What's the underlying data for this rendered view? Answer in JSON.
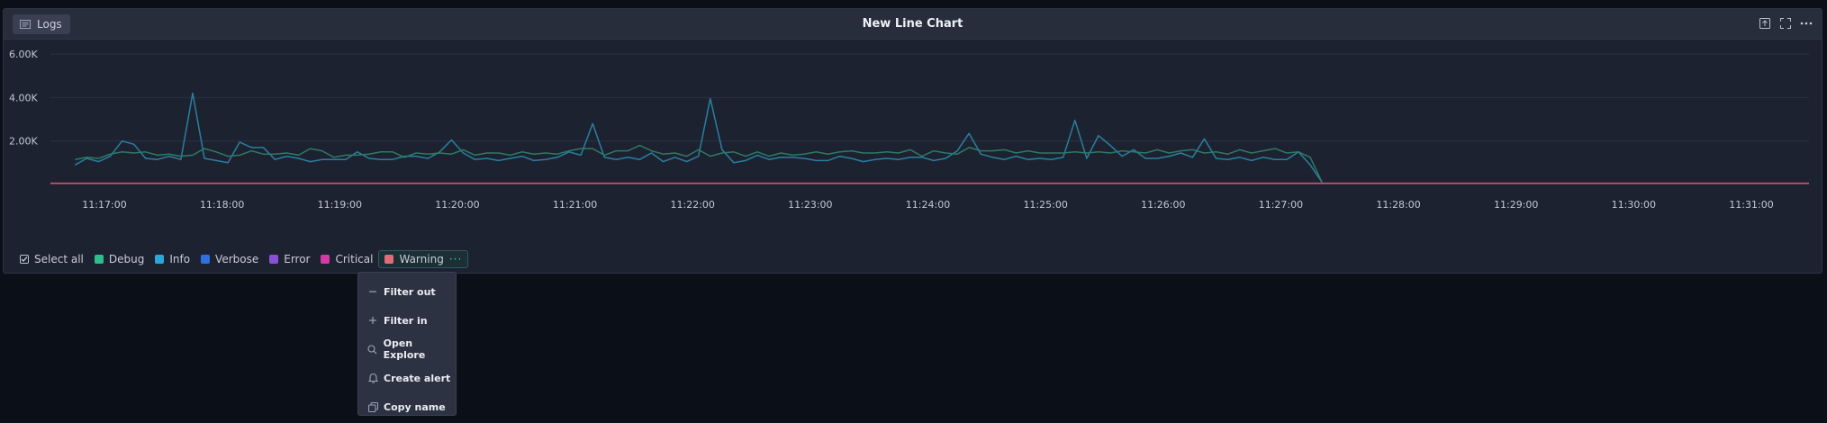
{
  "panel": {
    "logs_label": "Logs",
    "title": "New Line Chart",
    "header_icons": [
      "export-icon",
      "fullscreen-icon",
      "more-options-icon"
    ]
  },
  "legend": {
    "select_all": "Select all",
    "items": [
      {
        "label": "Debug",
        "color": "#2dbf8a"
      },
      {
        "label": "Info",
        "color": "#29a8d8"
      },
      {
        "label": "Verbose",
        "color": "#2f6fe0"
      },
      {
        "label": "Error",
        "color": "#8a4fd8"
      },
      {
        "label": "Critical",
        "color": "#d43aa4"
      },
      {
        "label": "Warning",
        "color": "#e36a7a"
      }
    ],
    "active_dots": "···"
  },
  "context_menu": {
    "items": [
      {
        "label": "Filter out",
        "icon": "minus-icon"
      },
      {
        "label": "Filter in",
        "icon": "plus-icon"
      },
      {
        "label": "Open Explore",
        "icon": "search-icon"
      },
      {
        "label": "Create alert",
        "icon": "bell-icon"
      },
      {
        "label": "Copy name",
        "icon": "copy-icon"
      }
    ]
  },
  "chart_data": {
    "type": "line",
    "title": "",
    "xlabel": "",
    "ylabel": "",
    "ylim": [
      0,
      6500
    ],
    "y_ticks": [
      {
        "value": 2000,
        "label": "2.00K"
      },
      {
        "value": 4000,
        "label": "4.00K"
      },
      {
        "value": 6000,
        "label": "6.00K"
      }
    ],
    "x_ticks": [
      "11:17:00",
      "11:18:00",
      "11:19:00",
      "11:20:00",
      "11:21:00",
      "11:22:00",
      "11:23:00",
      "11:24:00",
      "11:25:00",
      "11:26:00",
      "11:27:00",
      "11:28:00",
      "11:29:00",
      "11:30:00",
      "11:31:00"
    ],
    "x_start_minutes": 16.75,
    "x_step_minutes": 0.1,
    "series": [
      {
        "name": "Info",
        "color": "#2a7fa0",
        "values": [
          900,
          1200,
          1050,
          1300,
          2000,
          1850,
          1200,
          1150,
          1300,
          1150,
          4200,
          1200,
          1100,
          1000,
          1950,
          1700,
          1700,
          1150,
          1300,
          1200,
          1050,
          1150,
          1150,
          1150,
          1500,
          1200,
          1150,
          1150,
          1300,
          1300,
          1200,
          1500,
          2050,
          1450,
          1150,
          1200,
          1100,
          1200,
          1300,
          1100,
          1150,
          1250,
          1500,
          1350,
          2800,
          1250,
          1150,
          1250,
          1150,
          1450,
          1050,
          1250,
          1050,
          1300,
          3950,
          1600,
          1000,
          1100,
          1350,
          1150,
          1250,
          1250,
          1200,
          1100,
          1100,
          1300,
          1200,
          1050,
          1150,
          1200,
          1150,
          1250,
          1250,
          1100,
          1200,
          1550,
          2350,
          1400,
          1250,
          1150,
          1300,
          1150,
          1200,
          1150,
          1250,
          2950,
          1200,
          2250,
          1800,
          1300,
          1600,
          1200,
          1200,
          1300,
          1450,
          1250,
          2100,
          1200,
          1150,
          1250,
          1100,
          1250,
          1150,
          1150,
          1500,
          900,
          100
        ]
      },
      {
        "name": "Debug",
        "color": "#2e7a64",
        "values": [
          1150,
          1250,
          1200,
          1400,
          1500,
          1450,
          1500,
          1350,
          1400,
          1300,
          1350,
          1650,
          1500,
          1300,
          1350,
          1550,
          1400,
          1400,
          1450,
          1350,
          1650,
          1550,
          1250,
          1350,
          1350,
          1400,
          1500,
          1500,
          1250,
          1450,
          1400,
          1450,
          1400,
          1600,
          1350,
          1450,
          1450,
          1350,
          1500,
          1400,
          1450,
          1400,
          1550,
          1650,
          1650,
          1350,
          1550,
          1550,
          1800,
          1550,
          1400,
          1450,
          1300,
          1600,
          1300,
          1450,
          1500,
          1300,
          1500,
          1300,
          1450,
          1350,
          1400,
          1500,
          1400,
          1500,
          1550,
          1450,
          1450,
          1500,
          1450,
          1600,
          1300,
          1550,
          1450,
          1400,
          1700,
          1550,
          1550,
          1600,
          1450,
          1550,
          1450,
          1450,
          1450,
          1500,
          1450,
          1500,
          1450,
          1550,
          1500,
          1450,
          1600,
          1450,
          1550,
          1600,
          1450,
          1500,
          1400,
          1600,
          1450,
          1550,
          1650,
          1450,
          1500,
          1250,
          100
        ]
      },
      {
        "name": "Critical",
        "color": "#d63aa6",
        "values": [
          50,
          50
        ]
      },
      {
        "name": "Warning",
        "color": "#e0506c",
        "values": [
          60,
          60
        ]
      }
    ]
  }
}
